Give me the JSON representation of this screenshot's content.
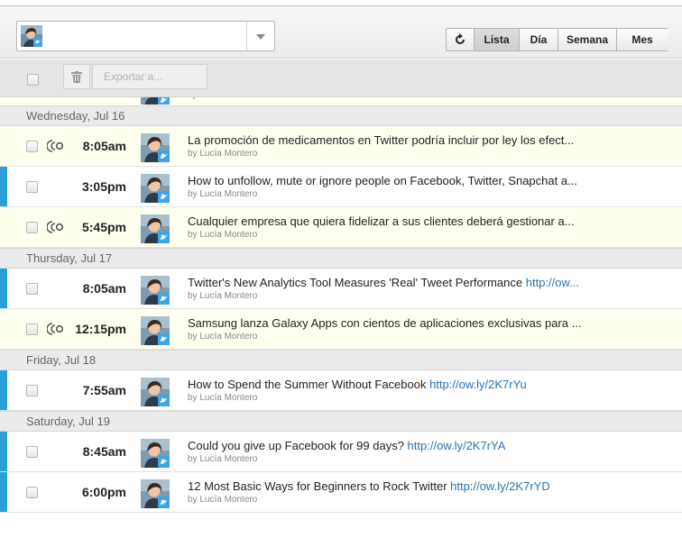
{
  "toolbar": {
    "profile_select": {
      "avatar": "profile-avatar-icon",
      "value": ""
    },
    "view_buttons": [
      {
        "label": "",
        "icon": "refresh-icon"
      },
      {
        "label": "Lista",
        "active": true
      },
      {
        "label": "Día"
      },
      {
        "label": "Semana"
      },
      {
        "label": "Mes"
      }
    ]
  },
  "actionbar": {
    "trash_icon": "trash-icon",
    "export_label": "Exportar a..."
  },
  "colors": {
    "accent_stripe": "#2a9fd8",
    "link": "#2a72b5",
    "highlight_row": "#fffff0"
  },
  "days": [
    {
      "label": "Wednesday, Jul 16",
      "posts": [
        {
          "time": "8:05am",
          "text": "La promoción de medicamentos en Twitter podría incluir por ley los efect...",
          "link": "",
          "by": "by Lucía Montero",
          "recurring": true,
          "highlight": true,
          "stripe": false
        },
        {
          "time": "3:05pm",
          "text": "How to unfollow, mute or ignore people on Facebook, Twitter, Snapchat a...",
          "link": "",
          "by": "by Lucía Montero",
          "recurring": false,
          "highlight": false,
          "stripe": true
        },
        {
          "time": "5:45pm",
          "text": "Cualquier empresa que quiera fidelizar a sus clientes deberá gestionar a...",
          "link": "",
          "by": "by Lucía Montero",
          "recurring": true,
          "highlight": true,
          "stripe": false
        }
      ]
    },
    {
      "label": "Thursday, Jul 17",
      "posts": [
        {
          "time": "8:05am",
          "text": "Twitter's New Analytics Tool Measures 'Real' Tweet Performance ",
          "link": "http://ow...",
          "by": "by Lucía Montero",
          "recurring": false,
          "highlight": false,
          "stripe": true
        },
        {
          "time": "12:15pm",
          "text": "Samsung lanza Galaxy Apps con cientos de aplicaciones exclusivas para ...",
          "link": "",
          "by": "by Lucía Montero",
          "recurring": true,
          "highlight": true,
          "stripe": false
        }
      ]
    },
    {
      "label": "Friday, Jul 18",
      "posts": [
        {
          "time": "7:55am",
          "text": "How to Spend the Summer Without Facebook ",
          "link": "http://ow.ly/2K7rYu",
          "by": "by Lucía Montero",
          "recurring": false,
          "highlight": false,
          "stripe": true
        }
      ]
    },
    {
      "label": "Saturday, Jul 19",
      "posts": [
        {
          "time": "8:45am",
          "text": "Could you give up Facebook for 99 days? ",
          "link": "http://ow.ly/2K7rYA",
          "by": "by Lucía Montero",
          "recurring": false,
          "highlight": false,
          "stripe": true
        },
        {
          "time": "6:00pm",
          "text": "12 Most Basic Ways for Beginners to Rock Twitter ",
          "link": "http://ow.ly/2K7rYD",
          "by": "by Lucía Montero",
          "recurring": false,
          "highlight": false,
          "stripe": true
        }
      ]
    }
  ]
}
